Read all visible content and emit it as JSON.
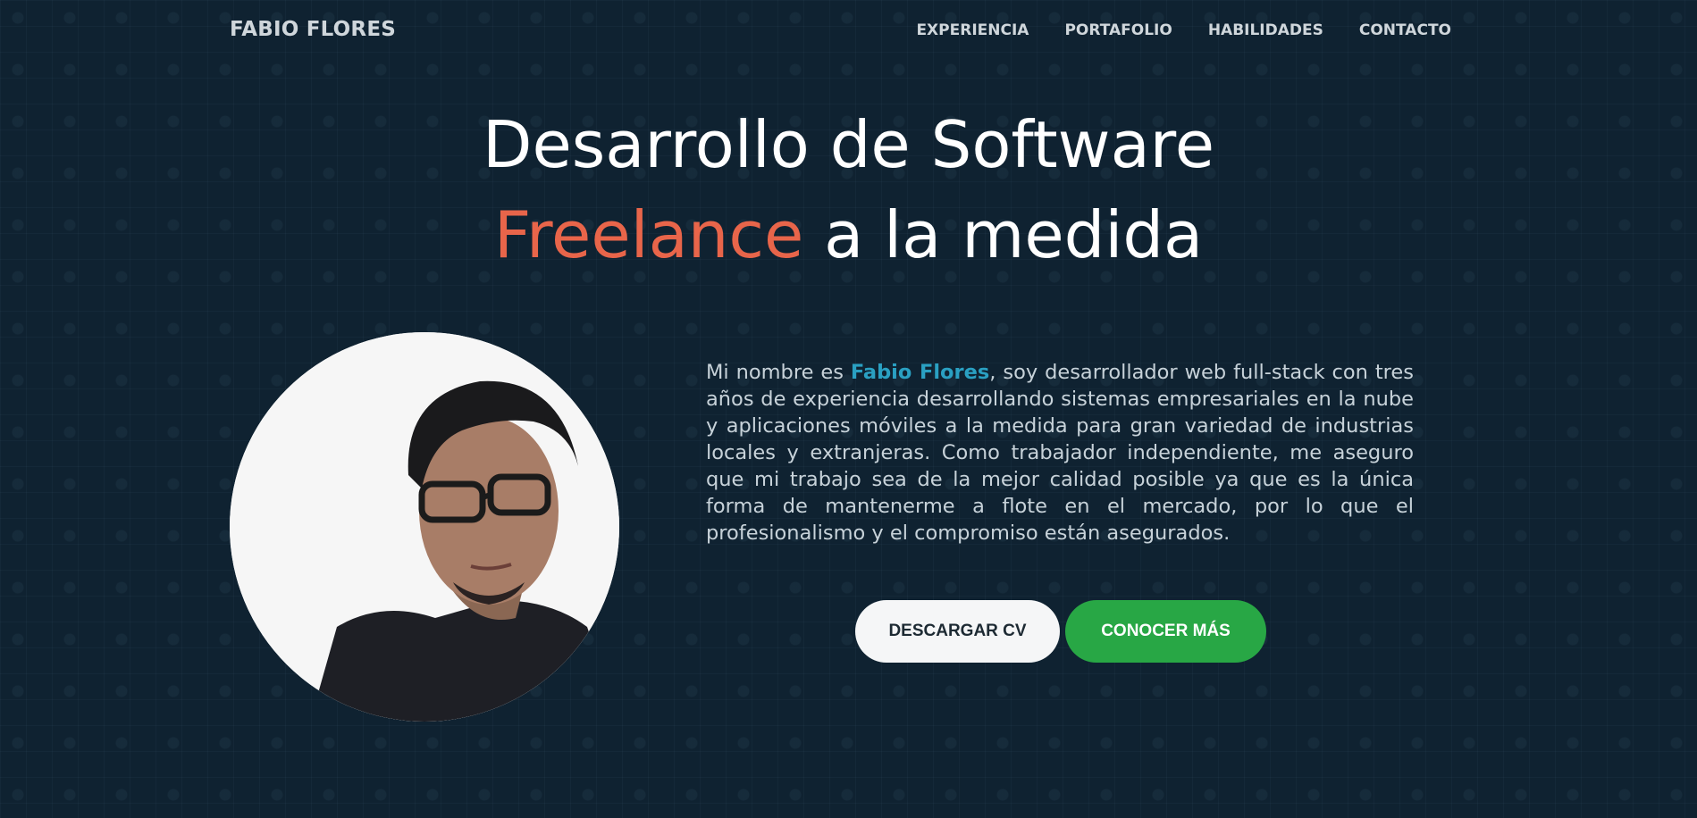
{
  "brand": "FABIO FLORES",
  "nav": {
    "items": [
      {
        "label": "EXPERIENCIA"
      },
      {
        "label": "PORTAFOLIO"
      },
      {
        "label": "HABILIDADES"
      },
      {
        "label": "CONTACTO"
      }
    ]
  },
  "hero": {
    "line1": "Desarrollo de Software",
    "line2_accent": "Freelance",
    "line2_rest": " a la medida",
    "accent_color": "#e8654a"
  },
  "bio": {
    "before": "Mi nombre es ",
    "name": "Fabio Flores",
    "after": ", soy desarrollador web full-stack con tres años de experiencia desarrollando sistemas empresariales en la nube y aplicaciones móviles a la medida para gran variedad de industrias locales y extranjeras. Como trabajador independiente, me aseguro que mi trabajo sea de la mejor calidad posible ya que es la única forma de mantenerme a flote en el mercado, por lo que el profesionalismo y el compromiso están asegurados."
  },
  "buttons": {
    "download_cv": "DESCARGAR CV",
    "learn_more": "CONOCER MÁS"
  },
  "colors": {
    "background": "#0f2231",
    "highlight": "#2aa0c2",
    "primary_button": "#28a745"
  }
}
